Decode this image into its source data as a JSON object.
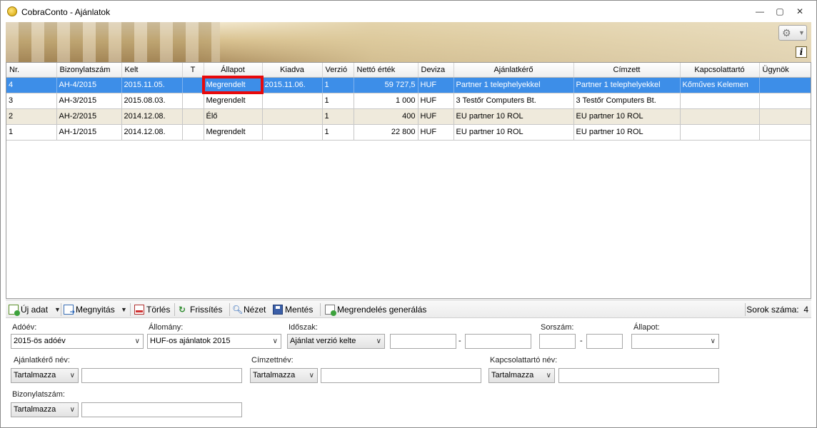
{
  "window": {
    "title": "CobraConto - Ajánlatok",
    "controls": {
      "minimize": "—",
      "maximize": "▢",
      "close": "✕"
    }
  },
  "grid": {
    "columns": [
      {
        "key": "nr",
        "label": "Nr."
      },
      {
        "key": "bizonylatszam",
        "label": "Bizonylatszám"
      },
      {
        "key": "kelt",
        "label": "Kelt"
      },
      {
        "key": "t",
        "label": "T"
      },
      {
        "key": "allapot",
        "label": "Állapot"
      },
      {
        "key": "kiadva",
        "label": "Kiadva"
      },
      {
        "key": "verzio",
        "label": "Verzió"
      },
      {
        "key": "netto",
        "label": "Nettó érték"
      },
      {
        "key": "deviza",
        "label": "Deviza"
      },
      {
        "key": "ajanlatkero",
        "label": "Ajánlatkérő"
      },
      {
        "key": "cimzett",
        "label": "Címzett"
      },
      {
        "key": "kapcsolattarto",
        "label": "Kapcsolattartó"
      },
      {
        "key": "ugynok",
        "label": "Ügynök"
      }
    ],
    "rows": [
      {
        "nr": "4",
        "bizonylatszam": "AH-4/2015",
        "kelt": "2015.11.05.",
        "t": "",
        "allapot": "Megrendelt",
        "kiadva": "2015.11.06.",
        "verzio": "1",
        "netto": "59 727,5",
        "deviza": "HUF",
        "ajanlatkero": "Partner 1 telephelyekkel",
        "cimzett": "Partner 1 telephelyekkel",
        "kapcsolattarto": "Kőműves Kelemen",
        "ugynok": ""
      },
      {
        "nr": "3",
        "bizonylatszam": "AH-3/2015",
        "kelt": "2015.08.03.",
        "t": "",
        "allapot": "Megrendelt",
        "kiadva": "",
        "verzio": "1",
        "netto": "1 000",
        "deviza": "HUF",
        "ajanlatkero": "3 Testőr Computers Bt.",
        "cimzett": "3 Testőr Computers Bt.",
        "kapcsolattarto": "",
        "ugynok": ""
      },
      {
        "nr": "2",
        "bizonylatszam": "AH-2/2015",
        "kelt": "2014.12.08.",
        "t": "",
        "allapot": "Élő",
        "kiadva": "",
        "verzio": "1",
        "netto": "400",
        "deviza": "HUF",
        "ajanlatkero": "EU partner 10 ROL",
        "cimzett": "EU partner 10 ROL",
        "kapcsolattarto": "",
        "ugynok": ""
      },
      {
        "nr": "1",
        "bizonylatszam": "AH-1/2015",
        "kelt": "2014.12.08.",
        "t": "",
        "allapot": "Megrendelt",
        "kiadva": "",
        "verzio": "1",
        "netto": "22 800",
        "deviza": "HUF",
        "ajanlatkero": "EU partner 10 ROL",
        "cimzett": "EU partner 10 ROL",
        "kapcsolattarto": "",
        "ugynok": ""
      }
    ],
    "selected_row": 0
  },
  "toolbar": {
    "new_label": "Új adat",
    "open_label": "Megnyitás",
    "delete_label": "Törlés",
    "refresh_label": "Frissítés",
    "view_label": "Nézet",
    "save_label": "Mentés",
    "generate_order_label": "Megrendelés generálás",
    "row_count_label": "Sorok száma:",
    "row_count": "4"
  },
  "filters": {
    "adoev_label": "Adóév:",
    "adoev_value": "2015-ös adóév",
    "allomany_label": "Állomány:",
    "allomany_value": "HUF-os ajánlatok 2015",
    "idoszak_label": "Időszak:",
    "idoszak_value": "Ajánlat verzió kelte",
    "idoszak_from": "",
    "idoszak_to": "",
    "sorszam_label": "Sorszám:",
    "sorszam_from": "",
    "sorszam_to": "",
    "allapot_label": "Állapot:",
    "allapot_value": "",
    "ajanlatkero_label": "Ajánlatkérő név:",
    "ajanlatkero_mode": "Tartalmazza",
    "ajanlatkero_value": "",
    "cimzett_label": "Címzettnév:",
    "cimzett_mode": "Tartalmazza",
    "cimzett_value": "",
    "kapcsolattarto_label": "Kapcsolattartó név:",
    "kapcsolattarto_mode": "Tartalmazza",
    "kapcsolattarto_value": "",
    "bizonylatszam_label": "Bizonylatszám:",
    "bizonylatszam_mode": "Tartalmazza",
    "bizonylatszam_value": "",
    "range_dash": "-"
  },
  "colors": {
    "selected_row": "#3d8ee8",
    "alt_row": "#efeadc",
    "highlight_box": "#e8090b"
  },
  "icons": {
    "gear": "gear-icon",
    "info": "info-icon",
    "app": "cobraconto-logo-icon"
  }
}
